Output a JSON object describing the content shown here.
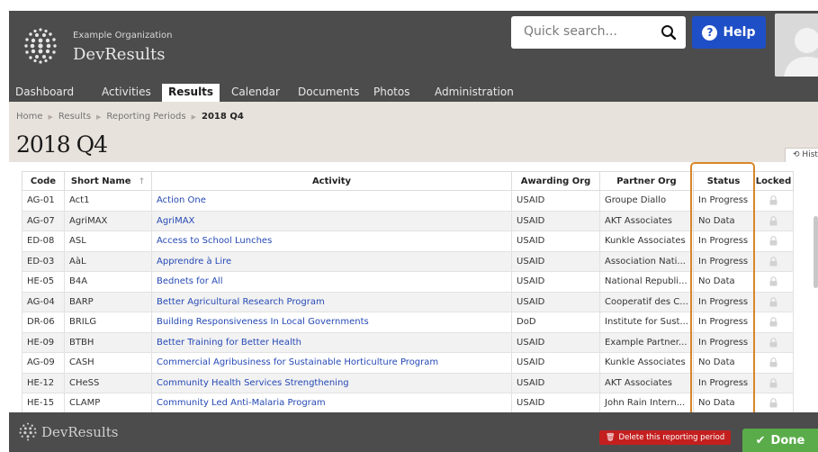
{
  "header": {
    "org_name": "Example Organization",
    "app_name": "DevResults",
    "search_placeholder": "Quick search...",
    "help_label": "Help"
  },
  "nav": {
    "items": [
      "Dashboard",
      "Activities",
      "Results",
      "Calendar",
      "Documents",
      "Photos",
      "Administration"
    ],
    "active": "Results"
  },
  "breadcrumb": {
    "items": [
      "Home",
      "Results",
      "Reporting Periods",
      "2018 Q4"
    ]
  },
  "page": {
    "title": "2018 Q4",
    "history_label": "History"
  },
  "table": {
    "columns": [
      "Code",
      "Short Name",
      "Activity",
      "Awarding Org",
      "Partner Org",
      "Status",
      "Locked"
    ],
    "sorted_column": "Short Name",
    "rows": [
      {
        "code": "AG-01",
        "short": "Act1",
        "activity": "Action One",
        "awarding": "USAID",
        "partner": "Groupe Diallo",
        "status": "In Progress"
      },
      {
        "code": "AG-07",
        "short": "AgriMAX",
        "activity": "AgriMAX",
        "awarding": "USAID",
        "partner": "AKT Associates",
        "status": "No Data"
      },
      {
        "code": "ED-08",
        "short": "ASL",
        "activity": "Access to School Lunches",
        "awarding": "USAID",
        "partner": "Kunkle Associates",
        "status": "In Progress"
      },
      {
        "code": "ED-03",
        "short": "AàL",
        "activity": "Apprendre à Lire",
        "awarding": "USAID",
        "partner": "Association Nati...",
        "status": "In Progress"
      },
      {
        "code": "HE-05",
        "short": "B4A",
        "activity": "Bednets for All",
        "awarding": "USAID",
        "partner": "National Republi...",
        "status": "No Data"
      },
      {
        "code": "AG-04",
        "short": "BARP",
        "activity": "Better Agricultural Research Program",
        "awarding": "USAID",
        "partner": "Cooperatif des C...",
        "status": "In Progress"
      },
      {
        "code": "DR-06",
        "short": "BRILG",
        "activity": "Building Responsiveness In Local Governments",
        "awarding": "DoD",
        "partner": "Institute for Sust...",
        "status": "In Progress"
      },
      {
        "code": "HE-09",
        "short": "BTBH",
        "activity": "Better Training for Better Health",
        "awarding": "USAID",
        "partner": "Example Partner...",
        "status": "In Progress"
      },
      {
        "code": "AG-09",
        "short": "CASH",
        "activity": "Commercial Agribusiness for Sustainable Horticulture Program",
        "awarding": "USAID",
        "partner": "Kunkle Associates",
        "status": "No Data"
      },
      {
        "code": "HE-12",
        "short": "CHeSS",
        "activity": "Community Health Services Strengthening",
        "awarding": "USAID",
        "partner": "AKT Associates",
        "status": "In Progress"
      },
      {
        "code": "HE-15",
        "short": "CLAMP",
        "activity": "Community Led Anti-Malaria Program",
        "awarding": "USAID",
        "partner": "John Rain Intern...",
        "status": "No Data"
      }
    ]
  },
  "footer": {
    "app_name": "DevResults",
    "delete_label": "Delete this reporting period",
    "done_label": "Done"
  },
  "colors": {
    "header_bg": "#4c4c4c",
    "accent_blue": "#1f4fc7",
    "link": "#2549b5",
    "highlight": "#d8862a",
    "delete": "#c41f1f",
    "done": "#5aac4a"
  }
}
